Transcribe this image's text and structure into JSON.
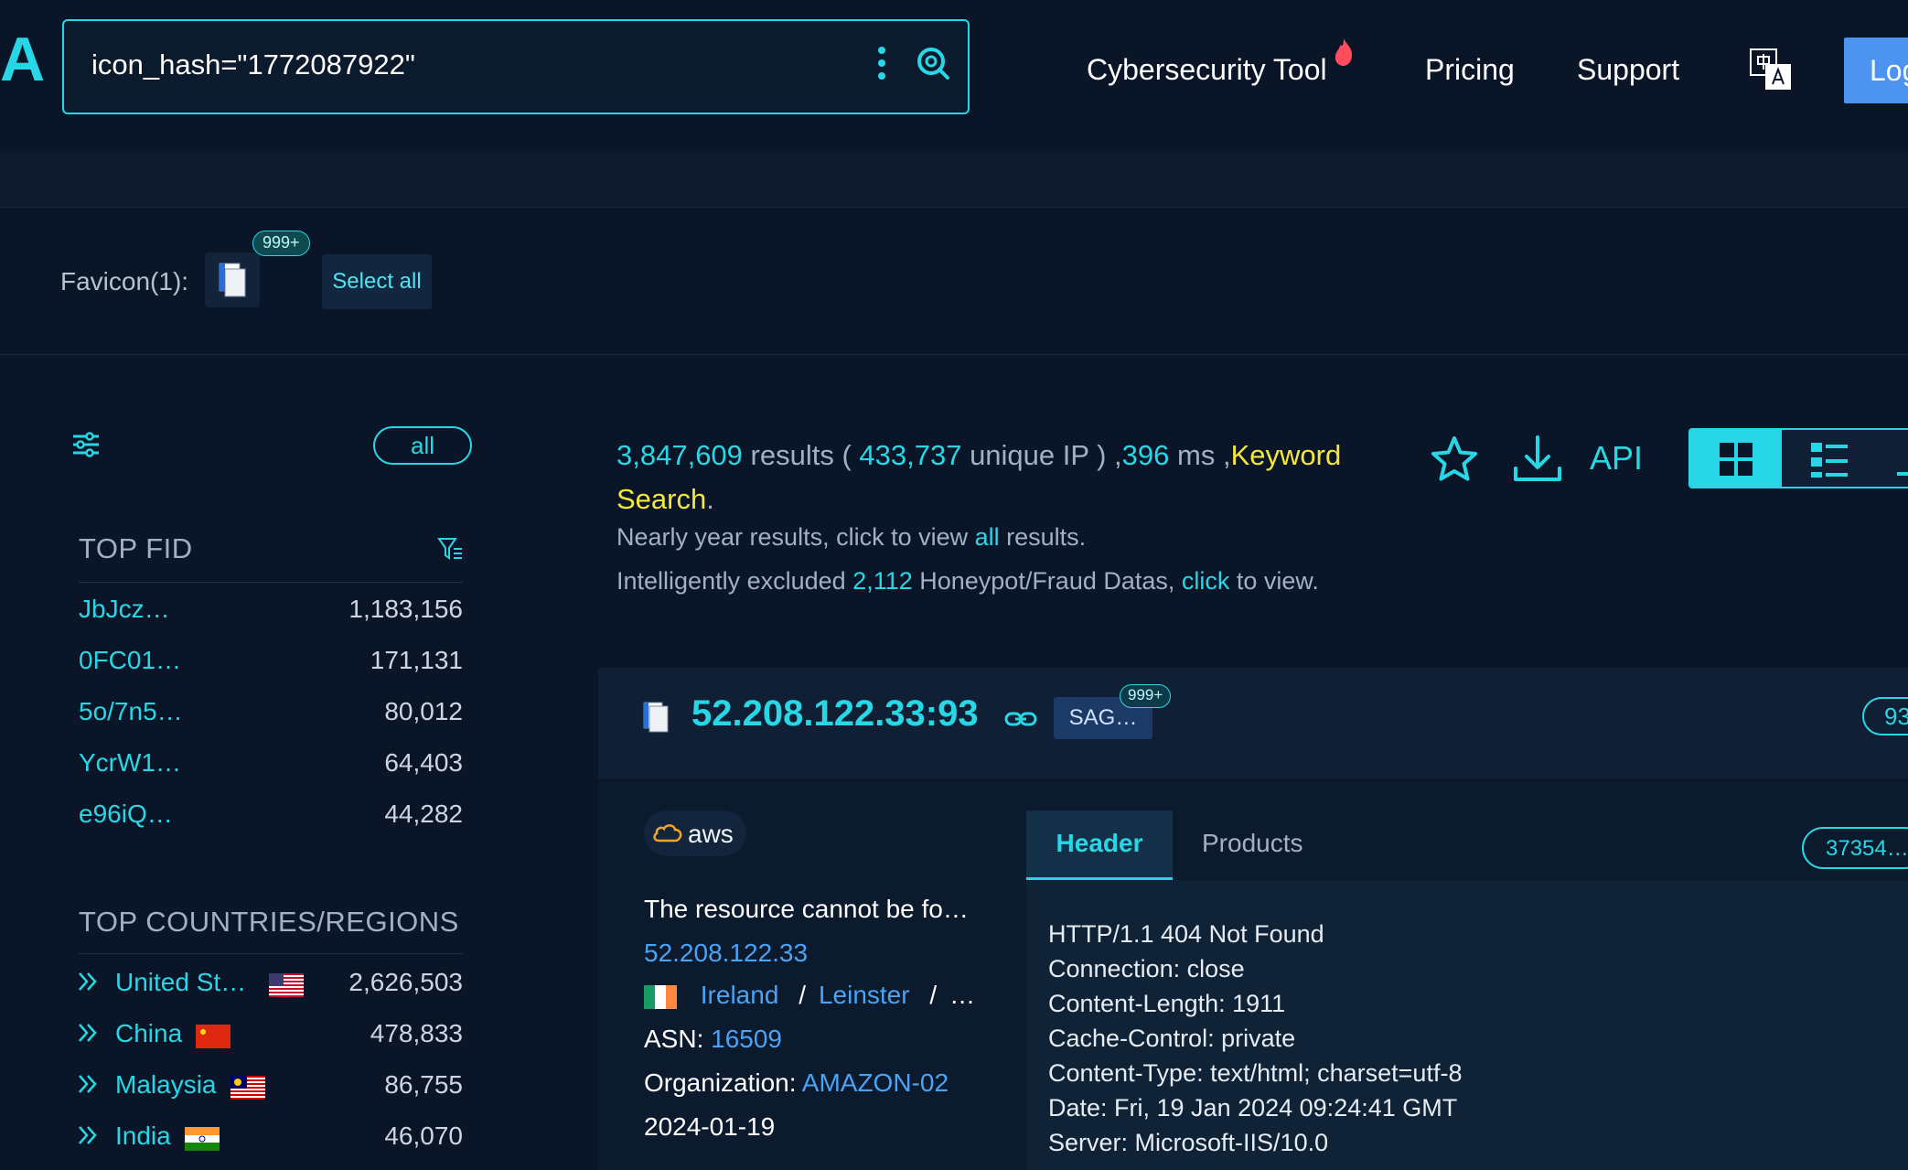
{
  "logo": {
    "glyph": "A"
  },
  "search": {
    "query": "icon_hash=\"1772087922\""
  },
  "nav": {
    "cybersecurity": "Cybersecurity Tool",
    "pricing": "Pricing",
    "support": "Support",
    "login": "Log"
  },
  "favicon": {
    "label": "Favicon(1):",
    "badge": "999+",
    "select_all": "Select all"
  },
  "sidebar": {
    "all_label": "all",
    "top_fid_title": "TOP FID",
    "fids": [
      {
        "name": "JbJcz…",
        "count": "1,183,156"
      },
      {
        "name": "0FC01…",
        "count": "171,131"
      },
      {
        "name": "5o/7n5…",
        "count": "80,012"
      },
      {
        "name": "YcrW1…",
        "count": "64,403"
      },
      {
        "name": "e96iQ…",
        "count": "44,282"
      }
    ],
    "countries_title": "TOP COUNTRIES/REGIONS",
    "countries": [
      {
        "name": "United St…",
        "count": "2,626,503"
      },
      {
        "name": "China",
        "count": "478,833"
      },
      {
        "name": "Malaysia",
        "count": "86,755"
      },
      {
        "name": "India",
        "count": "46,070"
      }
    ]
  },
  "results": {
    "total": "3,847,609",
    "results_word": " results ( ",
    "unique_ip": "433,737",
    "unique_word": " unique IP ) ,",
    "ms": "396",
    "ms_word": " ms ,",
    "keyword_search": "Keyword Search",
    "period": ".",
    "note1_pre": "Nearly year results, click to view ",
    "note1_link": "all",
    "note1_post": " results.",
    "note2_pre": "Intelligently excluded ",
    "note2_count": "2,112",
    "note2_mid": " Honeypot/Fraud Datas, ",
    "note2_link": "click",
    "note2_post": " to view.",
    "api": "API"
  },
  "card": {
    "host": "52.208.122.33:93",
    "tag": "SAG…",
    "tag_badge": "999+",
    "port_pill": "93",
    "cloud": "aws",
    "title": "The resource cannot be fo…",
    "ip": "52.208.122.33",
    "country": "Ireland",
    "sep": "/",
    "region": "Leinster",
    "ellipsis": "…",
    "asn_label": "ASN: ",
    "asn": "16509",
    "org_label": "Organization: ",
    "org": "AMAZON-02",
    "date": "2024-01-19",
    "tab_header": "Header",
    "tab_products": "Products",
    "hash": "37354…",
    "header_lines": [
      "HTTP/1.1 404 Not Found",
      "Connection: close",
      "Content-Length: 1911",
      "Cache-Control: private",
      "Content-Type: text/html; charset=utf-8",
      "Date: Fri, 19 Jan 2024 09:24:41 GMT",
      "Server: Microsoft-IIS/10.0"
    ]
  }
}
